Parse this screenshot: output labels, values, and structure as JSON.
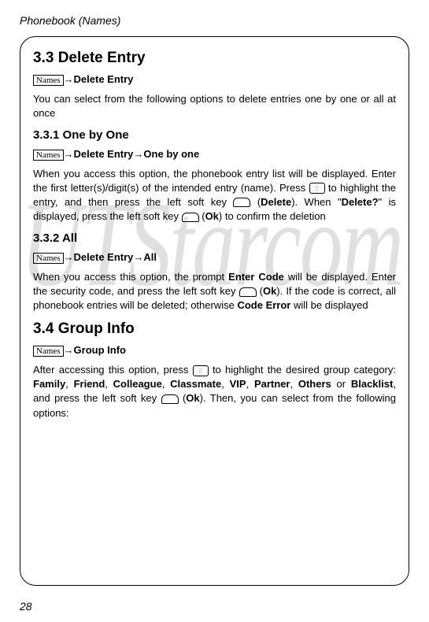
{
  "header": {
    "title": "Phonebook (Names)"
  },
  "watermark": "UTStarcom",
  "section33": {
    "heading": "3.3 Delete Entry",
    "navIcon": "Names",
    "navArrow": "→",
    "navTarget": "Delete Entry",
    "intro": "You can select from the following options to delete entries one by one or all at once"
  },
  "section331": {
    "heading": "3.3.1 One by One",
    "navIcon": "Names",
    "navArrow1": "→",
    "navMid": "Delete Entry",
    "navArrow2": "→",
    "navTarget": "One by one",
    "p1a": "When you access this option, the phonebook entry list will be displayed. Enter the first letter(s)/digit(s) of the intended entry (name). Press ",
    "p1b": " to highlight the entry, and then press the left soft key ",
    "p1c": " (",
    "p1d": "Delete",
    "p1e": "). When \"",
    "p1f": "Delete?",
    "p1g": "\" is displayed, press the left soft key ",
    "p1h": " (",
    "p1i": "Ok",
    "p1j": ") to confirm the deletion"
  },
  "section332": {
    "heading": "3.3.2 All",
    "navIcon": "Names",
    "navArrow1": "→",
    "navMid": "Delete Entry",
    "navArrow2": "→",
    "navTarget": "All",
    "p1a": "When you access this option, the prompt ",
    "p1b": "Enter Code",
    "p1c": " will be displayed. Enter the security code, and press the left soft key ",
    "p1d": " (",
    "p1e": "Ok",
    "p1f": "). If the code is correct, all phonebook entries will be deleted; otherwise ",
    "p1g": "Code Error",
    "p1h": " will be displayed"
  },
  "section34": {
    "heading": "3.4 Group Info",
    "navIcon": "Names",
    "navArrow": "→",
    "navTarget": "Group Info",
    "p1a": "After accessing this option, press ",
    "p1b": " to highlight the desired group category: ",
    "p1c": "Family",
    "p1d": ", ",
    "p1e": "Friend",
    "p1f": ", ",
    "p1g": "Colleague",
    "p1h": ", ",
    "p1i": "Classmate",
    "p1j": ", ",
    "p1k": "VIP",
    "p1l": ", ",
    "p1m": "Partner",
    "p1n": ", ",
    "p1o": "Others",
    "p1p": " or ",
    "p1q": "Blacklist",
    "p1r": ", and press the left soft key ",
    "p1s": " (",
    "p1t": "Ok",
    "p1u": "). Then, you can select from the following options:"
  },
  "pageNumber": "28"
}
